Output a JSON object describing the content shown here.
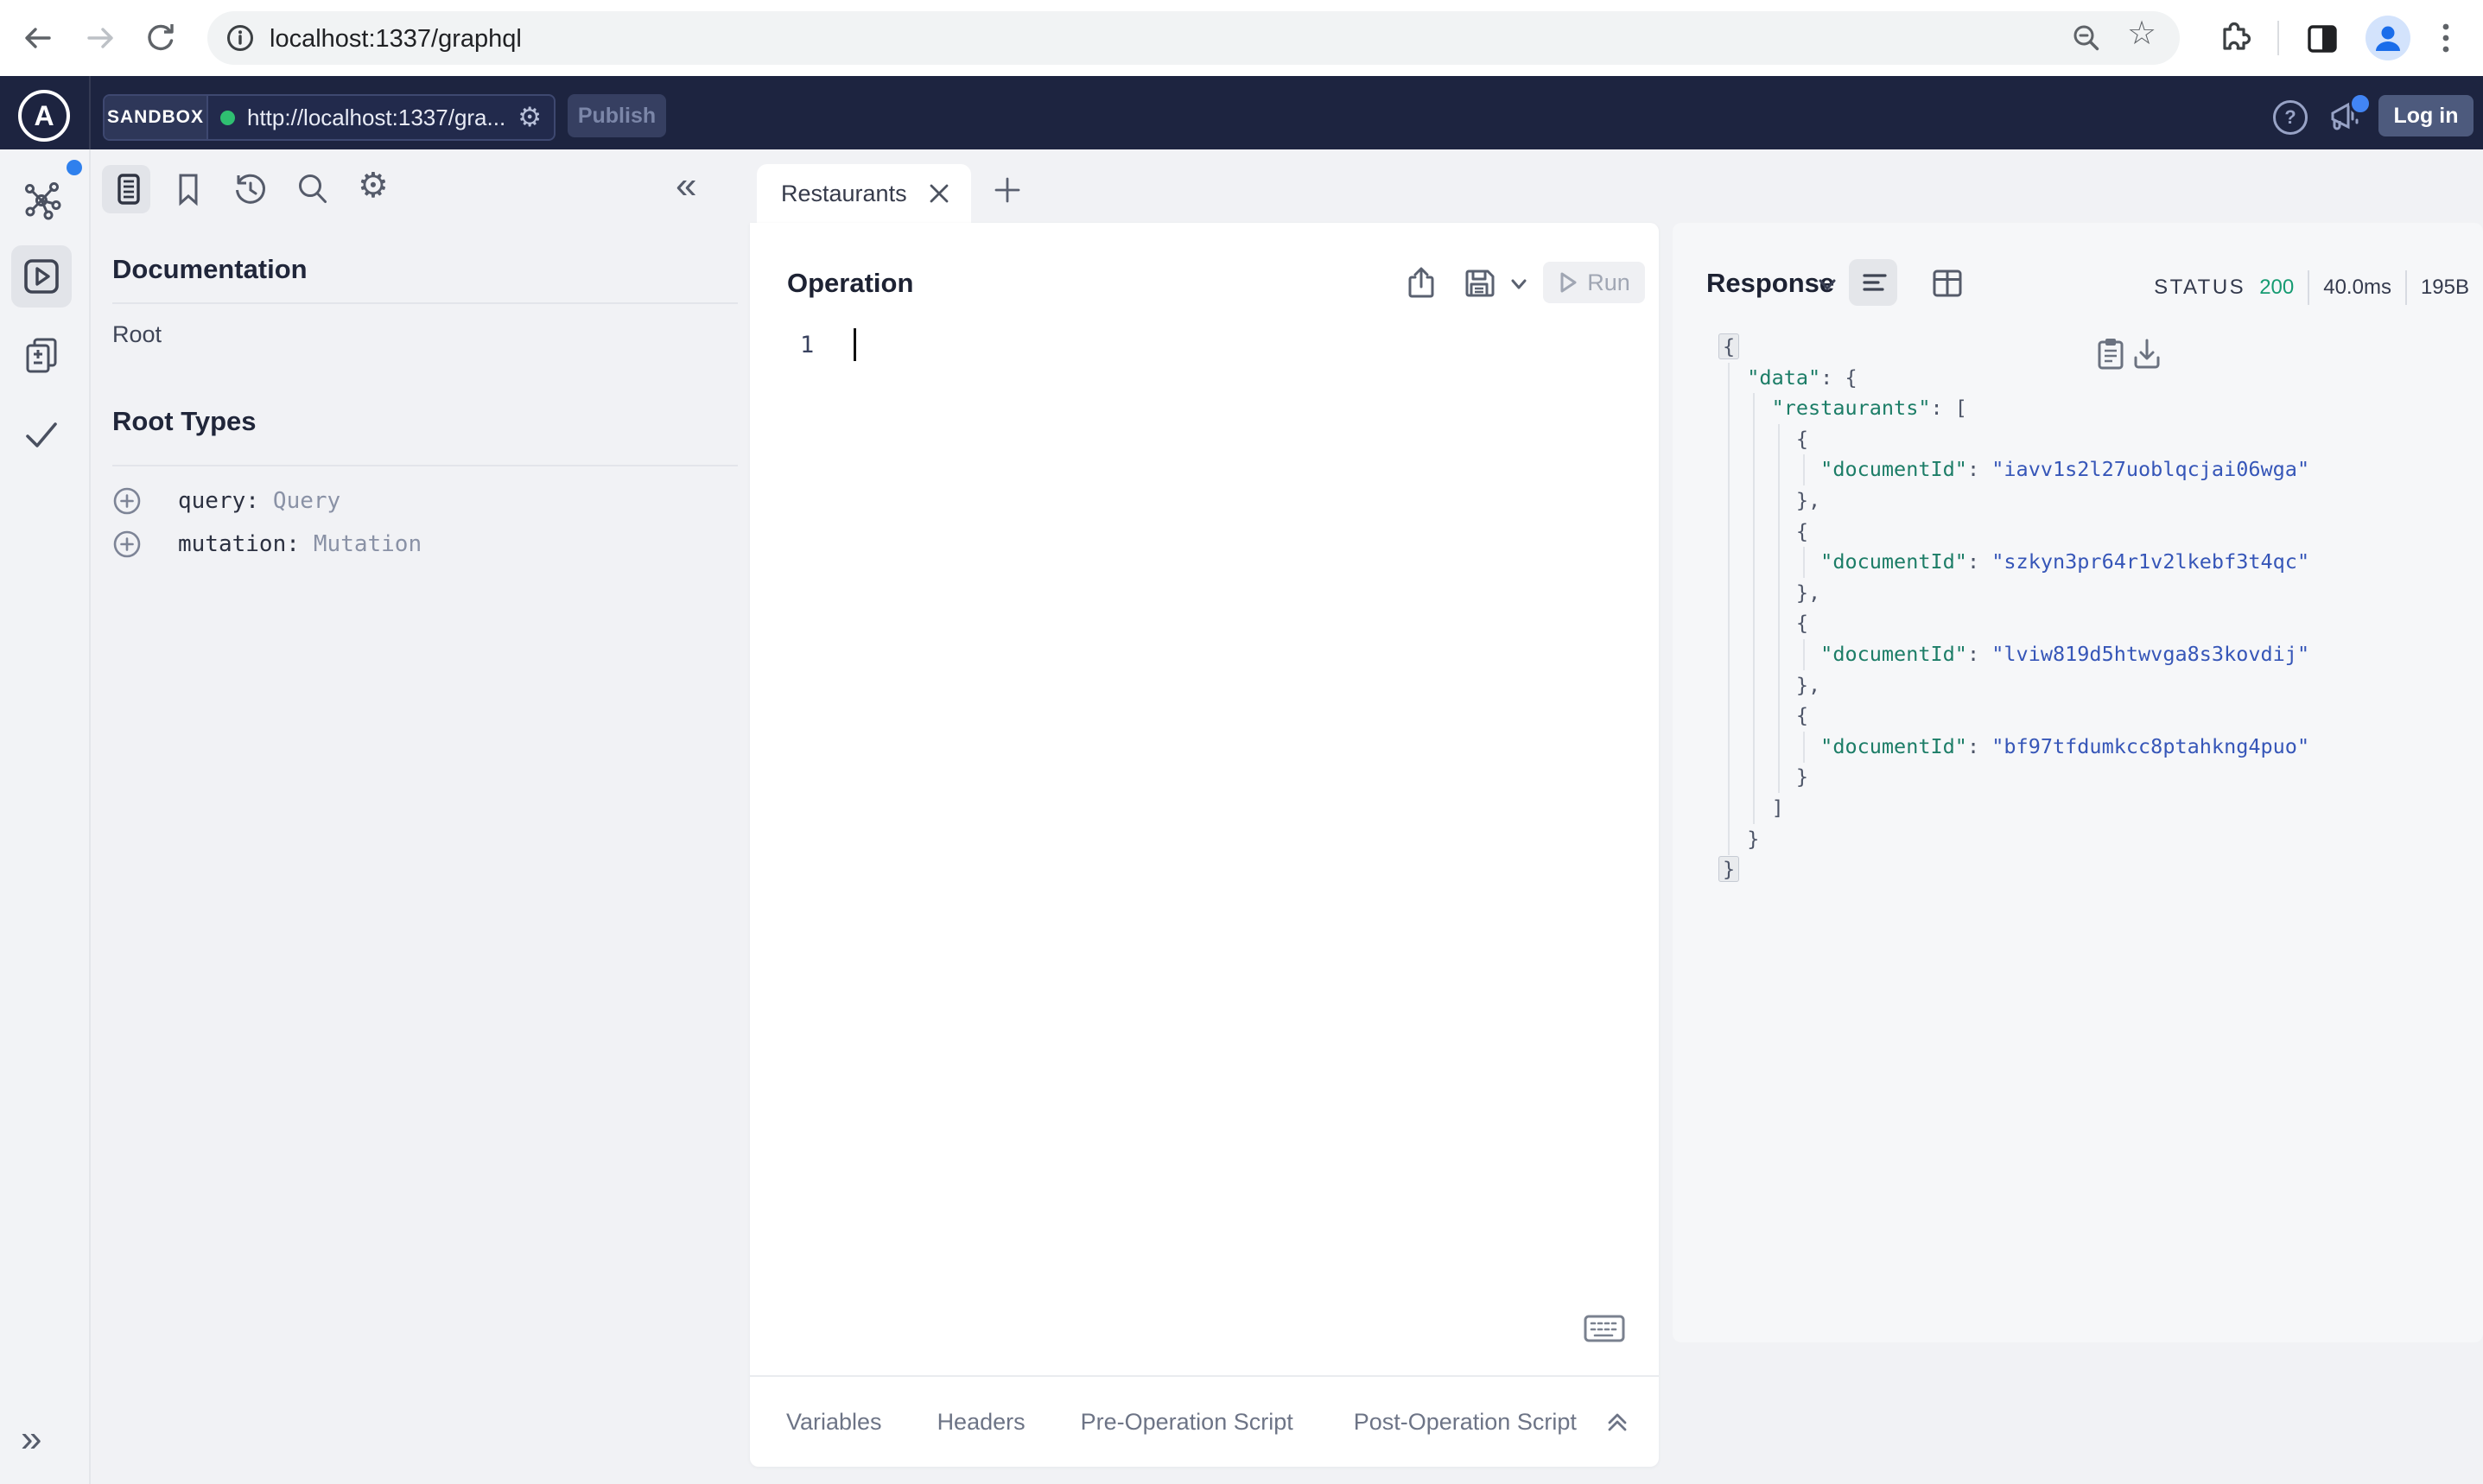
{
  "browser": {
    "url": "localhost:1337/graphql"
  },
  "icons": {
    "gear_glyph": "⚙",
    "star_glyph": "☆",
    "collapse_left_glyph": "«",
    "expand_right_glyph": "»",
    "help_glyph": "?"
  },
  "topbar": {
    "logo_letter": "A",
    "env_label": "SANDBOX",
    "endpoint_url": "http://localhost:1337/gra...",
    "publish_label": "Publish",
    "login_label": "Log in"
  },
  "doc_panel": {
    "title": "Documentation",
    "root_link": "Root",
    "section_title": "Root Types",
    "root_types": [
      {
        "field": "query:",
        "type": "Query"
      },
      {
        "field": "mutation:",
        "type": "Mutation"
      }
    ]
  },
  "tabs": {
    "active_label": "Restaurants"
  },
  "operation": {
    "title": "Operation",
    "run_label": "Run",
    "line_number": "1",
    "footer_tabs": [
      "Variables",
      "Headers",
      "Pre-Operation Script",
      "Post-Operation Script"
    ]
  },
  "response": {
    "title": "Response",
    "status_label": "STATUS",
    "status_code": "200",
    "time": "40.0ms",
    "size": "195B",
    "code_lines": [
      {
        "ind": 0,
        "toks": [
          [
            "pb",
            "{"
          ]
        ]
      },
      {
        "ind": 2,
        "toks": [
          [
            "key",
            "\"data\""
          ],
          [
            "p",
            ": {"
          ]
        ]
      },
      {
        "ind": 4,
        "toks": [
          [
            "key",
            "\"restaurants\""
          ],
          [
            "p",
            ": ["
          ]
        ]
      },
      {
        "ind": 6,
        "toks": [
          [
            "p",
            "{"
          ]
        ]
      },
      {
        "ind": 8,
        "toks": [
          [
            "key",
            "\"documentId\""
          ],
          [
            "p",
            ": "
          ],
          [
            "str",
            "\"iavv1s2l27uoblqcjai06wga\""
          ]
        ]
      },
      {
        "ind": 6,
        "toks": [
          [
            "p",
            "},"
          ]
        ]
      },
      {
        "ind": 6,
        "toks": [
          [
            "p",
            "{"
          ]
        ]
      },
      {
        "ind": 8,
        "toks": [
          [
            "key",
            "\"documentId\""
          ],
          [
            "p",
            ": "
          ],
          [
            "str",
            "\"szkyn3pr64r1v2lkebf3t4qc\""
          ]
        ]
      },
      {
        "ind": 6,
        "toks": [
          [
            "p",
            "},"
          ]
        ]
      },
      {
        "ind": 6,
        "toks": [
          [
            "p",
            "{"
          ]
        ]
      },
      {
        "ind": 8,
        "toks": [
          [
            "key",
            "\"documentId\""
          ],
          [
            "p",
            ": "
          ],
          [
            "str",
            "\"lviw819d5htwvga8s3kovdij\""
          ]
        ]
      },
      {
        "ind": 6,
        "toks": [
          [
            "p",
            "},"
          ]
        ]
      },
      {
        "ind": 6,
        "toks": [
          [
            "p",
            "{"
          ]
        ]
      },
      {
        "ind": 8,
        "toks": [
          [
            "key",
            "\"documentId\""
          ],
          [
            "p",
            ": "
          ],
          [
            "str",
            "\"bf97tfdumkcc8ptahkng4puo\""
          ]
        ]
      },
      {
        "ind": 6,
        "toks": [
          [
            "p",
            "}"
          ]
        ]
      },
      {
        "ind": 4,
        "toks": [
          [
            "p",
            "]"
          ]
        ]
      },
      {
        "ind": 2,
        "toks": [
          [
            "p",
            "}"
          ]
        ]
      },
      {
        "ind": 0,
        "toks": [
          [
            "pb",
            "}"
          ]
        ]
      }
    ]
  },
  "colors": {
    "navy_bar": "#1d2440",
    "status_green": "#169b72",
    "json_key": "#1c7d67",
    "json_string": "#3656b8",
    "accent_blue": "#2f80ed"
  }
}
